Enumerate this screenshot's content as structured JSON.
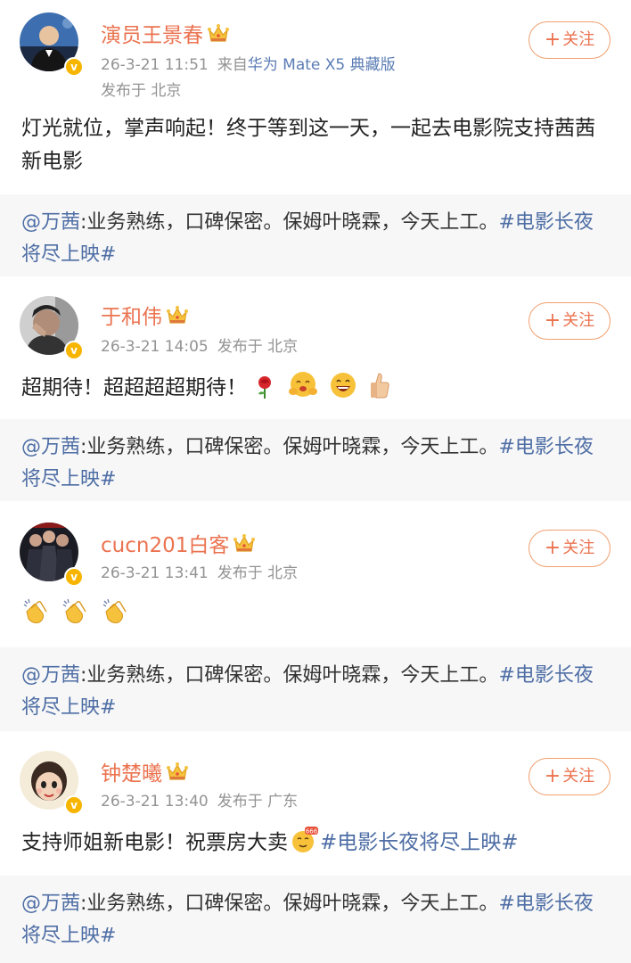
{
  "posts": [
    {
      "name": "演员王景春",
      "time": "26-3-21 11:51",
      "source_prefix": "来自",
      "source_device": "华为 Mate X5 典藏版",
      "location": "发布于 北京",
      "text": "灯光就位，掌声响起！终于等到这一天，一起去电影院支持茜茜新电影",
      "follow_label": "关注"
    },
    {
      "name": "于和伟",
      "time": "26-3-21 14:05",
      "location": "发布于 北京",
      "text": "超期待！超超超超期待！",
      "emojis": [
        "rose-icon",
        "hug-icon",
        "laugh-icon",
        "thumbs-up-icon"
      ],
      "follow_label": "关注"
    },
    {
      "name": "cucn201白客",
      "time": "26-3-21 13:41",
      "location": "发布于 北京",
      "emojis": [
        "clap-icon",
        "clap-icon",
        "clap-icon"
      ],
      "follow_label": "关注"
    },
    {
      "name": "钟楚曦",
      "time": "26-3-21 13:40",
      "location": "发布于 广东",
      "text": "支持师姐新电影！祝票房大卖",
      "emojis": [
        "666-icon"
      ],
      "tag": "#电影长夜将尽上映#",
      "follow_label": "关注"
    }
  ],
  "repost": {
    "at": "@万茜",
    "body": ":业务熟练，口碑保密。保姆叶晓霖，今天上工。",
    "tag": "#电影长夜将尽上映#"
  },
  "colors": {
    "name": "#eb7350",
    "link": "#4e6ea5",
    "meta": "#939393",
    "repost_bg": "#f7f7f7",
    "badge": "#f7b500"
  }
}
